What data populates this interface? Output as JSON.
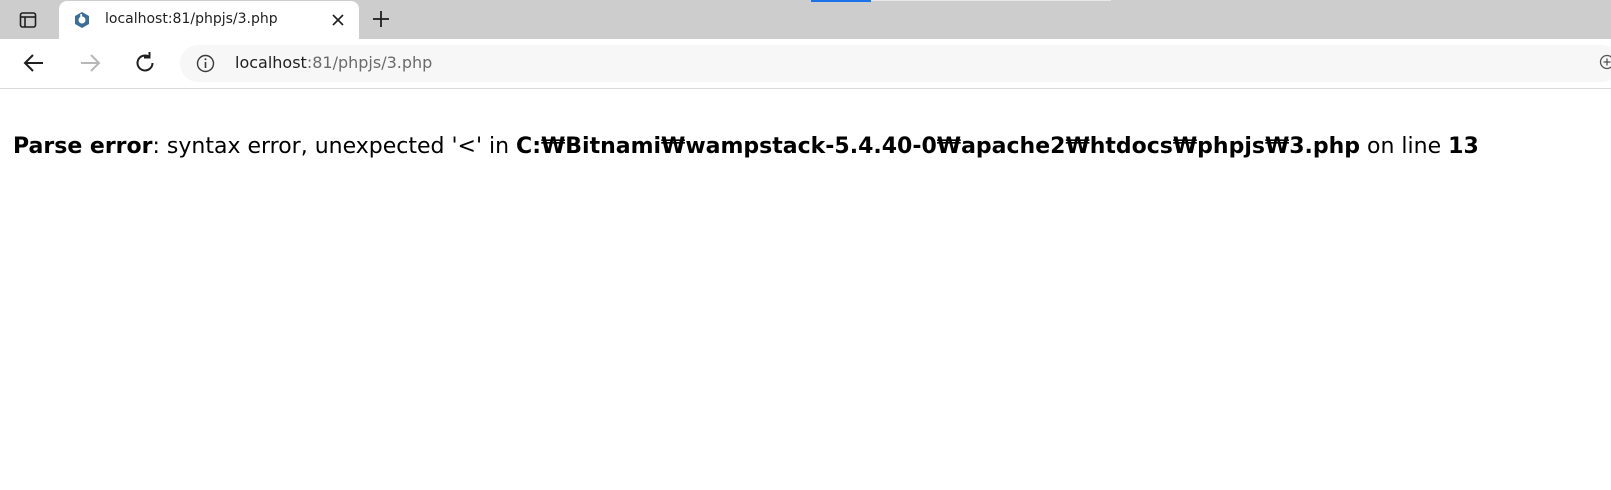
{
  "browser": {
    "tab": {
      "title": "localhost:81/phpjs/3.php"
    },
    "address_bar": {
      "url_host": "localhost",
      "url_rest": ":81/phpjs/3.php"
    },
    "colors": {
      "tabbar_bg": "#cdcdcd",
      "active_tab_bg": "#ffffff",
      "accent": "#1a73e8"
    }
  },
  "page": {
    "error_label": "Parse error",
    "error_message": ": syntax error, unexpected '<' in ",
    "file_path": "C:₩Bitnami₩wampstack-5.4.40-0₩apache2₩htdocs₩phpjs₩3.php",
    "on_line_text": " on line ",
    "line_number": "13"
  }
}
